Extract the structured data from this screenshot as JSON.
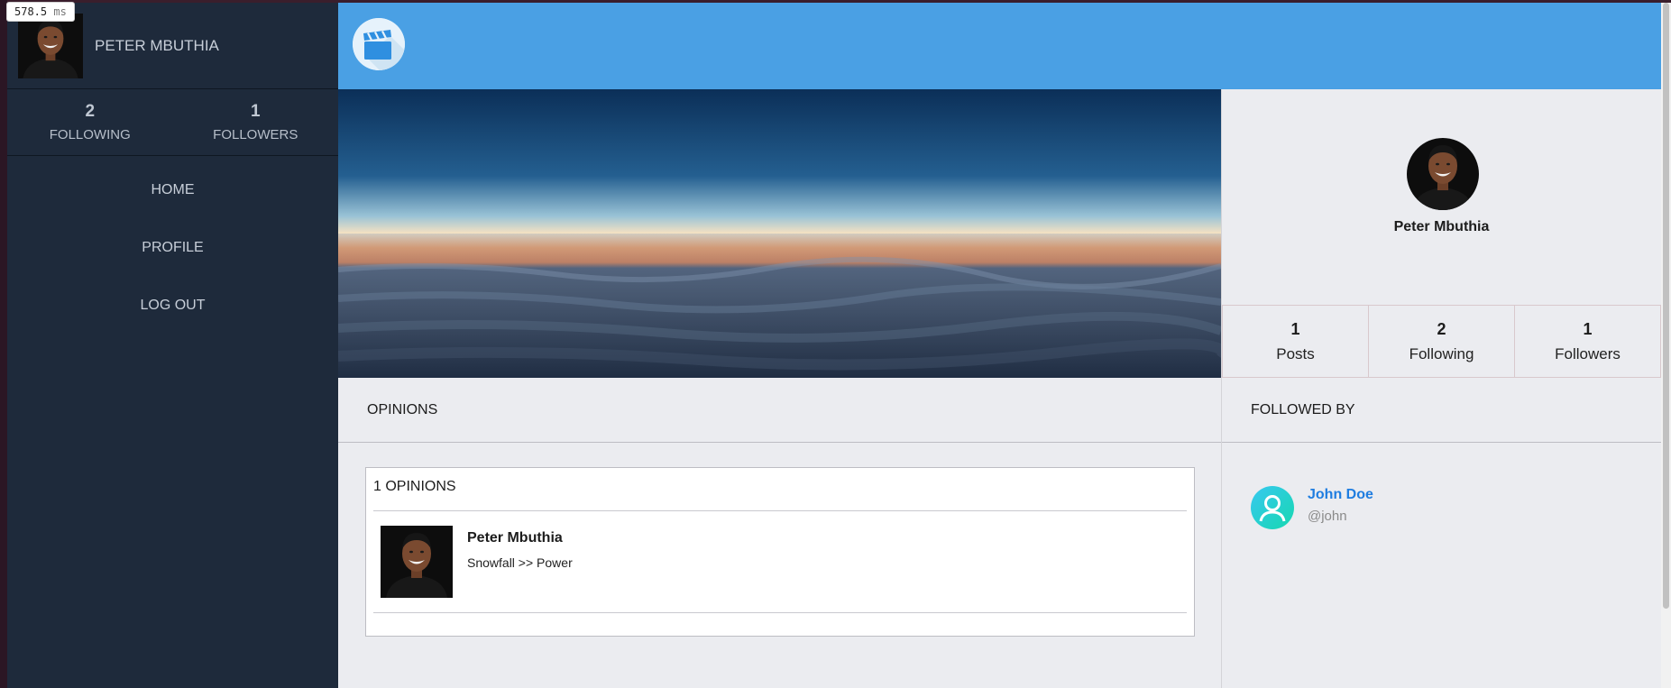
{
  "perf": {
    "value": "578.5",
    "unit": "ms"
  },
  "sidebar": {
    "user_name": "PETER MBUTHIA",
    "stats": [
      {
        "count": "2",
        "label": "FOLLOWING"
      },
      {
        "count": "1",
        "label": "FOLLOWERS"
      }
    ],
    "nav": [
      {
        "label": "HOME"
      },
      {
        "label": "PROFILE"
      },
      {
        "label": "LOG OUT"
      }
    ]
  },
  "header": {
    "logo_icon": "clapperboard-icon",
    "bg_color": "#4aa0e4"
  },
  "profile": {
    "name": "Peter Mbuthia",
    "stats": [
      {
        "count": "1",
        "label": "Posts"
      },
      {
        "count": "2",
        "label": "Following"
      },
      {
        "count": "1",
        "label": "Followers"
      }
    ]
  },
  "opinions": {
    "heading": "OPINIONS",
    "count_label": "1 OPINIONS",
    "items": [
      {
        "author": "Peter Mbuthia",
        "text": "Snowfall >> Power"
      }
    ]
  },
  "followed_by": {
    "heading": "FOLLOWED BY",
    "users": [
      {
        "name": "John Doe",
        "handle": "@john"
      }
    ]
  },
  "colors": {
    "sidebar": "#1e2a3b",
    "accent_link": "#1f7de0",
    "panel_bg": "#ebecf0"
  }
}
